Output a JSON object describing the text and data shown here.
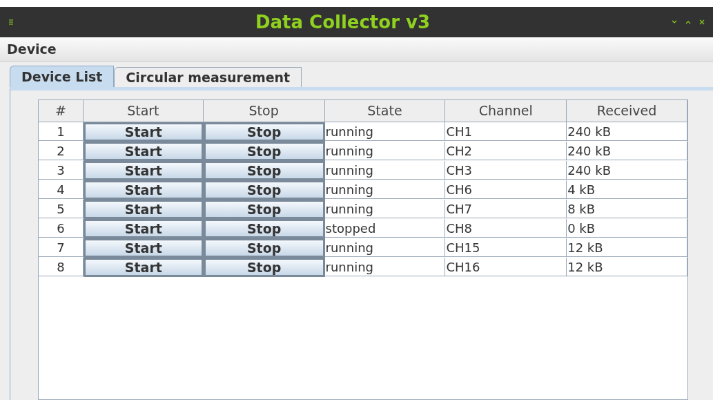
{
  "window": {
    "title": "Data Collector v3"
  },
  "menu": [
    "Device"
  ],
  "tabs": [
    {
      "label": "Device List",
      "selected": true
    },
    {
      "label": "Circular measurement",
      "selected": false
    }
  ],
  "table": {
    "columns": [
      "#",
      "Start",
      "Stop",
      "State",
      "Channel",
      "Received"
    ],
    "rows": [
      {
        "index": "1",
        "start": "Start",
        "stop": "Stop",
        "state": "running",
        "channel": "CH1",
        "received": "240 kB"
      },
      {
        "index": "2",
        "start": "Start",
        "stop": "Stop",
        "state": "running",
        "channel": "CH2",
        "received": "240 kB"
      },
      {
        "index": "3",
        "start": "Start",
        "stop": "Stop",
        "state": "running",
        "channel": "CH3",
        "received": "240 kB"
      },
      {
        "index": "4",
        "start": "Start",
        "stop": "Stop",
        "state": "running",
        "channel": "CH6",
        "received": "4 kB"
      },
      {
        "index": "5",
        "start": "Start",
        "stop": "Stop",
        "state": "running",
        "channel": "CH7",
        "received": "8 kB"
      },
      {
        "index": "6",
        "start": "Start",
        "stop": "Stop",
        "state": "stopped",
        "channel": "CH8",
        "received": "0 kB"
      },
      {
        "index": "7",
        "start": "Start",
        "stop": "Stop",
        "state": "running",
        "channel": "CH15",
        "received": "12 kB"
      },
      {
        "index": "8",
        "start": "Start",
        "stop": "Stop",
        "state": "running",
        "channel": "CH16",
        "received": "12 kB"
      }
    ]
  }
}
